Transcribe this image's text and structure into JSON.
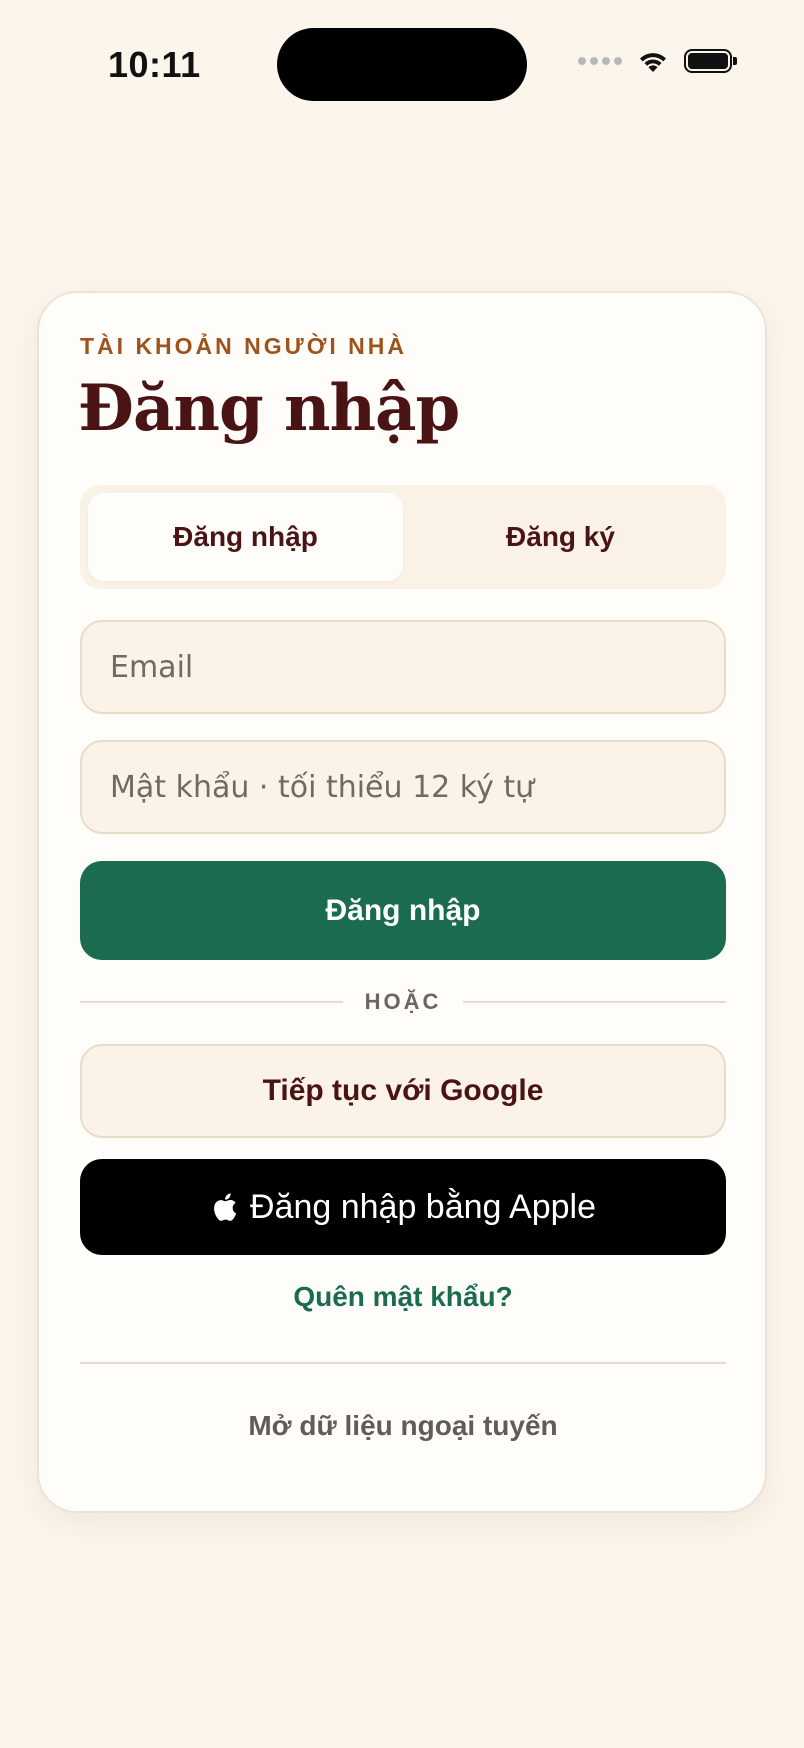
{
  "status_bar": {
    "time": "10:11",
    "icons": [
      "signal-icon",
      "wifi-icon",
      "battery-icon"
    ]
  },
  "card": {
    "eyebrow": "TÀI KHOẢN NGƯỜI NHÀ",
    "title": "Đăng nhập",
    "tabs": [
      {
        "label": "Đăng nhập",
        "active": true
      },
      {
        "label": "Đăng ký",
        "active": false
      }
    ],
    "email": {
      "placeholder": "Email",
      "value": ""
    },
    "password": {
      "placeholder": "Mật khẩu · tối thiểu 12 ký tự",
      "value": ""
    },
    "submit_label": "Đăng nhập",
    "or_label": "HOẶC",
    "google_label": "Tiếp tục với Google",
    "apple_label": "Đăng nhập bằng Apple",
    "forgot_label": "Quên mật khẩu?",
    "offline_label": "Mở dữ liệu ngoại tuyến"
  },
  "colors": {
    "background": "#fbf5ec",
    "accent_green": "#1a6b50",
    "title_maroon": "#4a1414",
    "eyebrow_orange": "#a0521c"
  }
}
